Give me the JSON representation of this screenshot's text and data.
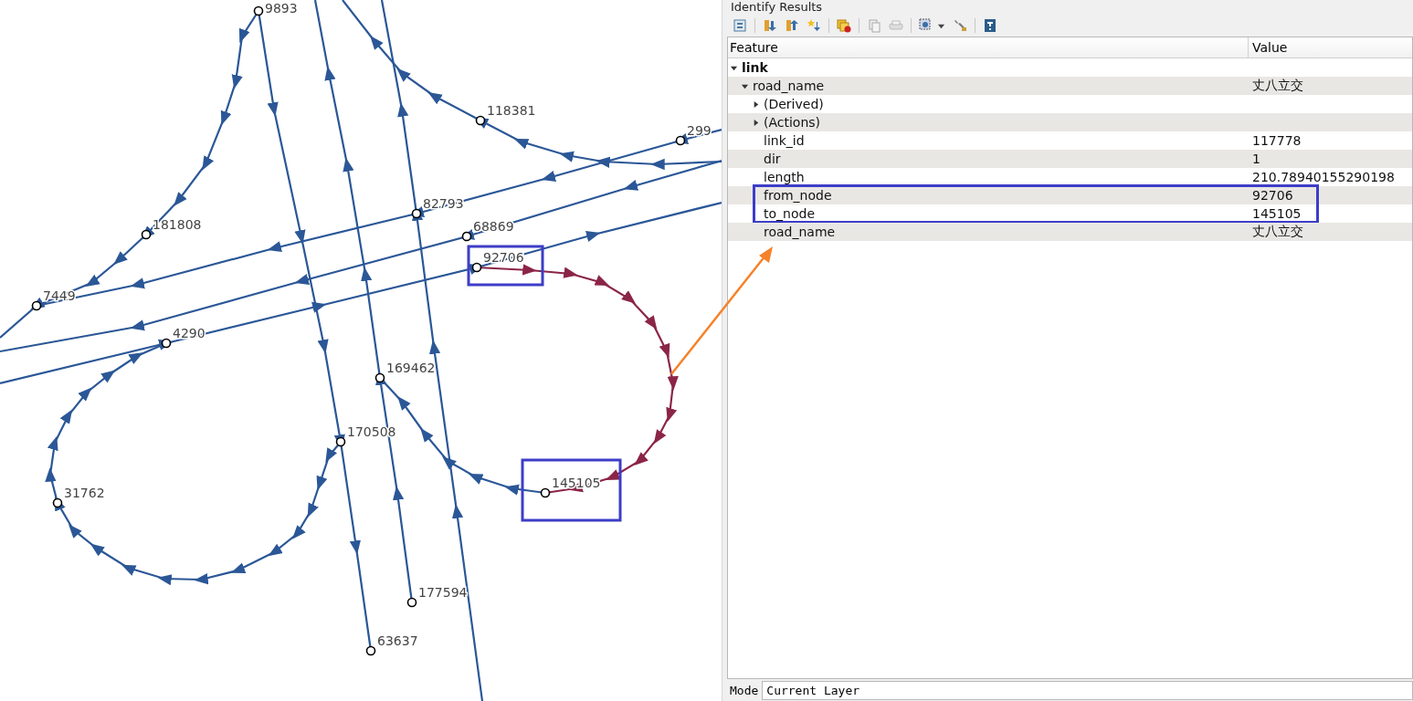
{
  "map": {
    "nodes": [
      {
        "label": "9893"
      },
      {
        "label": "118381"
      },
      {
        "label": "299"
      },
      {
        "label": "82793"
      },
      {
        "label": "181808"
      },
      {
        "label": "68869"
      },
      {
        "label": "92706",
        "highlighted": true
      },
      {
        "label": "7449"
      },
      {
        "label": "4290"
      },
      {
        "label": "169462"
      },
      {
        "label": "170508"
      },
      {
        "label": "31762"
      },
      {
        "label": "145105",
        "highlighted": true
      },
      {
        "label": "177594"
      },
      {
        "label": "63637"
      }
    ]
  },
  "panel": {
    "title": "Identify Results",
    "columns": [
      "Feature",
      "Value"
    ],
    "tree": [
      {
        "feature": "link",
        "expanded": true,
        "children": [
          {
            "feature": "road_name",
            "value": "丈八立交",
            "expanded": true,
            "children": [
              {
                "feature": "(Derived)",
                "expanded": false
              },
              {
                "feature": "(Actions)",
                "expanded": false
              },
              {
                "feature": "link_id",
                "value": "117778"
              },
              {
                "feature": "dir",
                "value": "1"
              },
              {
                "feature": "length",
                "value": "210.78940155290198"
              },
              {
                "feature": "from_node",
                "value": "92706",
                "highlighted": true
              },
              {
                "feature": "to_node",
                "value": "145105",
                "highlighted": true
              },
              {
                "feature": "road_name",
                "value": "丈八立交"
              }
            ]
          }
        ]
      }
    ],
    "mode": {
      "label": "Mode",
      "value": "Current Layer"
    }
  }
}
